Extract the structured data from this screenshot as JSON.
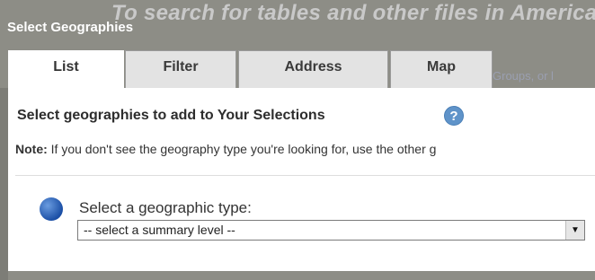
{
  "background": {
    "text": "To search for tables and other files in America"
  },
  "dialog": {
    "title": "Select Geographies",
    "tabs": [
      {
        "label": "List",
        "active": true
      },
      {
        "label": "Filter",
        "active": false
      },
      {
        "label": "Address",
        "active": false
      },
      {
        "label": "Map",
        "active": false
      }
    ],
    "tab_extra_text": "Groups, or l",
    "heading": "Select geographies to add to Your Selections",
    "help_icon": "question-mark",
    "note_bold": "Note:",
    "note_text": " If you don't see the geography type you're looking for, use the other ",
    "note_link": "g",
    "step_label": "Select a geographic type:",
    "select_value": "-- select a summary level --",
    "colors": {
      "accent_blue": "#1b4fa6",
      "help_blue": "#5f93c9",
      "dialog_frame": "#8d8d86"
    }
  }
}
